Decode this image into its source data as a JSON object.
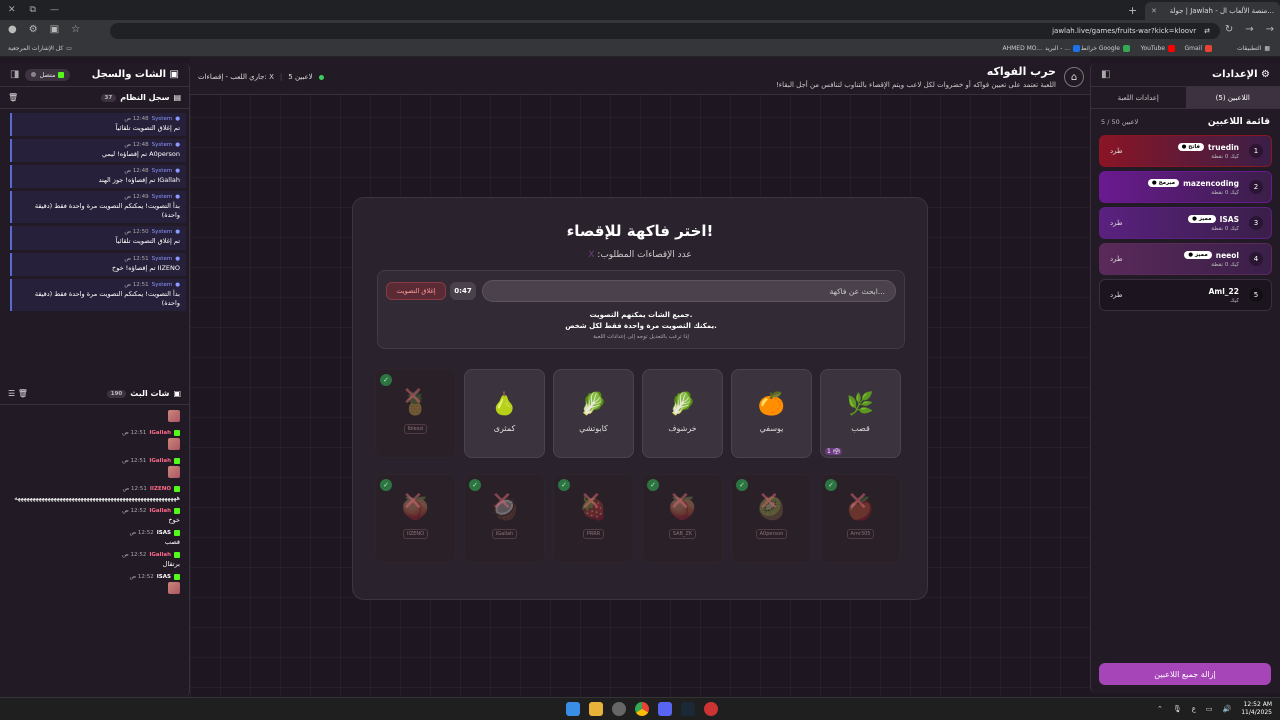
{
  "browser": {
    "tab_title": "جولة | Jawlah - منصة الألعاب ال...",
    "url": "jawlah.live/games/fruits-war?kick=kloovr",
    "bookmarks": [
      {
        "label": "التطبيقات",
        "color": "#999"
      },
      {
        "label": "Gmail",
        "color": "#ea4335"
      },
      {
        "label": "YouTube",
        "color": "#ff0000"
      },
      {
        "label": "خرائط Google",
        "color": "#34a853"
      },
      {
        "label": "البريد - ...",
        "color": "#1a73e8"
      },
      {
        "label": "AHMED MO...",
        "color": "#666"
      }
    ],
    "all_bookmarks": "كل الإشارات المرجعية"
  },
  "right_panel": {
    "title": "الإعدادات",
    "tabs": [
      {
        "label": "اللاعبين (5)"
      },
      {
        "label": "إعدادات اللعبة"
      }
    ],
    "list_title": "قائمة اللاعبين",
    "count": "5 / 50 لاعبين",
    "remove_all": "إزالة جميع اللاعبين",
    "players": [
      {
        "rank": "1",
        "name": "truedin",
        "badge": "● فاتح",
        "platform": "كيك",
        "points": "0 نقطة",
        "kick": "طرد",
        "bg": "#8a1525"
      },
      {
        "rank": "2",
        "name": "mazencoding",
        "badge": "● مبرمج",
        "platform": "كيك",
        "points": "0 نقطة",
        "kick": "",
        "bg": "#6a1a90"
      },
      {
        "rank": "3",
        "name": "ISAS",
        "badge": "● مميز",
        "platform": "كيك",
        "points": "0 نقطة",
        "kick": "طرد",
        "bg": "#5a2180"
      },
      {
        "rank": "4",
        "name": "neeol",
        "badge": "● مميز",
        "platform": "كيك",
        "points": "0 نقطة",
        "kick": "طرد",
        "bg": "#5a2a5a"
      },
      {
        "rank": "5",
        "name": "Aml_22",
        "badge": "",
        "platform": "كيك",
        "points": "",
        "kick": "طرد",
        "bg": "#1c151f"
      }
    ]
  },
  "game": {
    "title": "حرب الفواكه",
    "desc": "اللعبة تعتمد على تعيين فواكه أو خضروات لكل لاعب ويتم الإقصاء بالتناوب لتنافس من أجل البقاء!",
    "players_online": "5 لاعبين",
    "status": "جاري اللعب - إقصاءات: X",
    "modal": {
      "title": "اختر فاكهة للإقصاء!",
      "subtitle": "عدد الإقصاءات المطلوب:",
      "subtitle_x": "X",
      "search_placeholder": "ابحث عن فاكهة...",
      "timer": "0:47",
      "close_vote": "إغلاق التصويت",
      "note1": "جميع الشات يمكنهم التصويت.",
      "note2": "يمكنك التصويت مرة واحدة فقط لكل شخص.",
      "note3": "إذا ترغب بالتعديل توجه إلى إعدادات اللعبة"
    },
    "fruits_row1": [
      {
        "name": "قصب",
        "emoji": "🌿",
        "votes": "1 🗳"
      },
      {
        "name": "يوسفي",
        "emoji": "🍊"
      },
      {
        "name": "خرشوف",
        "emoji": "🥬"
      },
      {
        "name": "كابوتشي",
        "emoji": "🥬"
      },
      {
        "name": "كمثرى",
        "emoji": "🍐"
      },
      {
        "name": "Iblessl",
        "emoji": "🍍",
        "elim": true
      }
    ],
    "fruits_row2": [
      {
        "name": "Amr305",
        "emoji": "🍎"
      },
      {
        "name": "A0person",
        "emoji": "🥝"
      },
      {
        "name": "SAB_ZK",
        "emoji": "🍑"
      },
      {
        "name": "PRRR",
        "emoji": "🍓"
      },
      {
        "name": "IGallah",
        "emoji": "🥥"
      },
      {
        "name": "IIZENO",
        "emoji": "🍑"
      }
    ]
  },
  "left_panel": {
    "title": "الشات والسجل",
    "status": "متصل",
    "syslog_title": "سجل النظام",
    "syslog_count": "37",
    "sys": [
      {
        "user": "System",
        "time": "12:48 ص",
        "msg": "تم إغلاق التصويت تلقائياً"
      },
      {
        "user": "System",
        "time": "12:48 ص",
        "msg": "A0person تم إقصاؤه! ليمي"
      },
      {
        "user": "System",
        "time": "12:48 ص",
        "msg": "IGallah تم إقصاؤه! جوز الهند"
      },
      {
        "user": "System",
        "time": "12:49 ص",
        "msg": "بدأ التصويت! يمكنكم التصويت مرة واحدة فقط (دقيقة واحدة)"
      },
      {
        "user": "System",
        "time": "12:50 ص",
        "msg": "تم إغلاق التصويت تلقائياً"
      },
      {
        "user": "System",
        "time": "12:51 ص",
        "msg": "IIZENO تم إقصاؤه! خوخ"
      },
      {
        "user": "System",
        "time": "12:51 ص",
        "msg": "بدأ التصويت! يمكنكم التصويت مرة واحدة فقط (دقيقة واحدة)"
      }
    ],
    "live_title": "شات البث",
    "live_count": "190",
    "chat": [
      {
        "user": "",
        "time": "",
        "msg": "",
        "emote": true
      },
      {
        "user": "IGallah",
        "time": "12:51 ص",
        "msg": "",
        "emote": true,
        "color": "#ff6a8a"
      },
      {
        "user": "IGallah",
        "time": "12:51 ص",
        "msg": "",
        "emote": true,
        "color": "#ff6a8a"
      },
      {
        "user": "IIZENO",
        "time": "12:51 ص",
        "msg": "ههههههههههههههههههههههههههههههههههههههههههههههههههههههه",
        "color": "#ff6a8a"
      },
      {
        "user": "IGallah",
        "time": "12:52 ص",
        "msg": "خوخ",
        "color": "#ff6a8a"
      },
      {
        "user": "ISAS",
        "time": "12:52 ص",
        "msg": "قصب",
        "color": "#ffffff"
      },
      {
        "user": "IGallah",
        "time": "12:52 ص",
        "msg": "برتقال",
        "color": "#ff6a8a"
      },
      {
        "user": "ISAS",
        "time": "12:52 ص",
        "msg": "",
        "emote": true,
        "color": "#ffffff"
      }
    ]
  },
  "taskbar": {
    "time": "12:52 AM",
    "date": "11/4/2025",
    "lang": "ع"
  }
}
